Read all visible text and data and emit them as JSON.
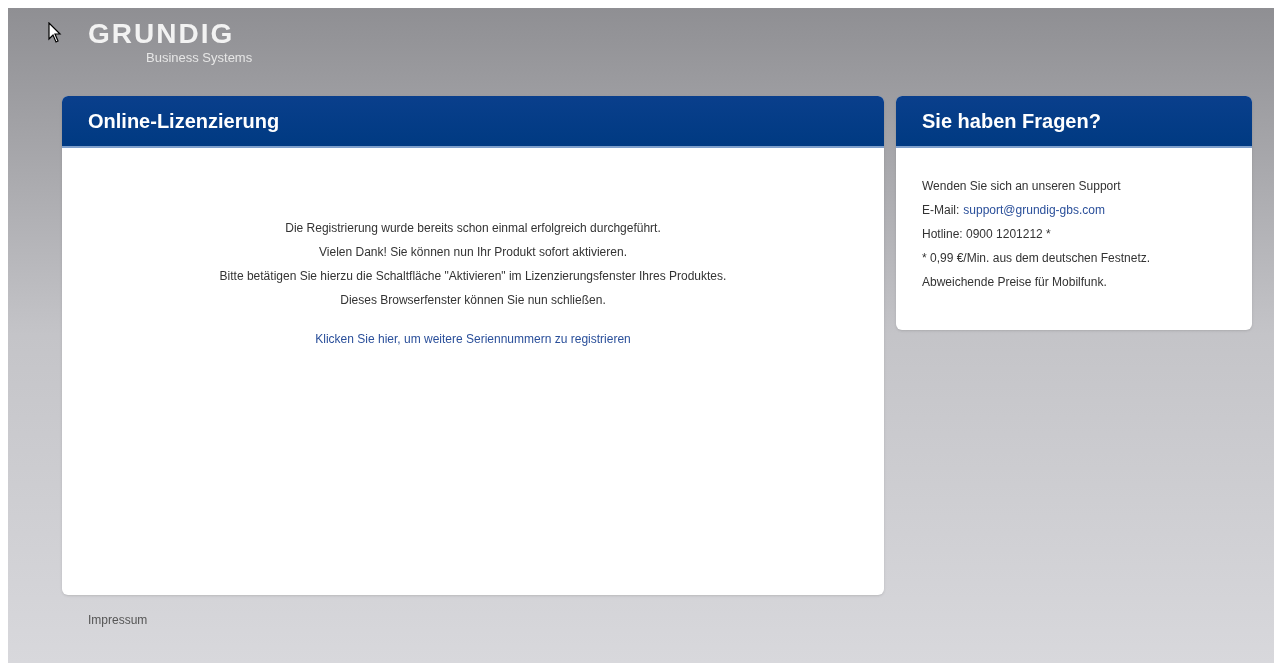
{
  "logo": {
    "wordmark": "GRUNDIG",
    "tagline": "Business Systems"
  },
  "main_panel": {
    "title": "Online-Lizenzierung",
    "lines": [
      "Die Registrierung wurde bereits schon einmal erfolgreich durchgeführt.",
      "Vielen Dank! Sie können nun Ihr Produkt sofort aktivieren.",
      "Bitte betätigen Sie hierzu die Schaltfläche \"Aktivieren\" im Lizenzierungsfenster Ihres Produktes.",
      "Dieses Browserfenster können Sie nun schließen."
    ],
    "link": "Klicken Sie hier, um weitere Seriennummern zu registrieren"
  },
  "support_panel": {
    "title": "Sie haben Fragen?",
    "intro": "Wenden Sie sich an unseren Support",
    "email_label": "E-Mail:",
    "email": "support@grundig-gbs.com",
    "hotline": "Hotline: 0900 1201212 *",
    "note_lines": [
      "* 0,99 €/Min. aus dem deutschen Festnetz.",
      "Abweichende Preise für Mobilfunk."
    ]
  },
  "footer": {
    "link": "Impressum"
  }
}
